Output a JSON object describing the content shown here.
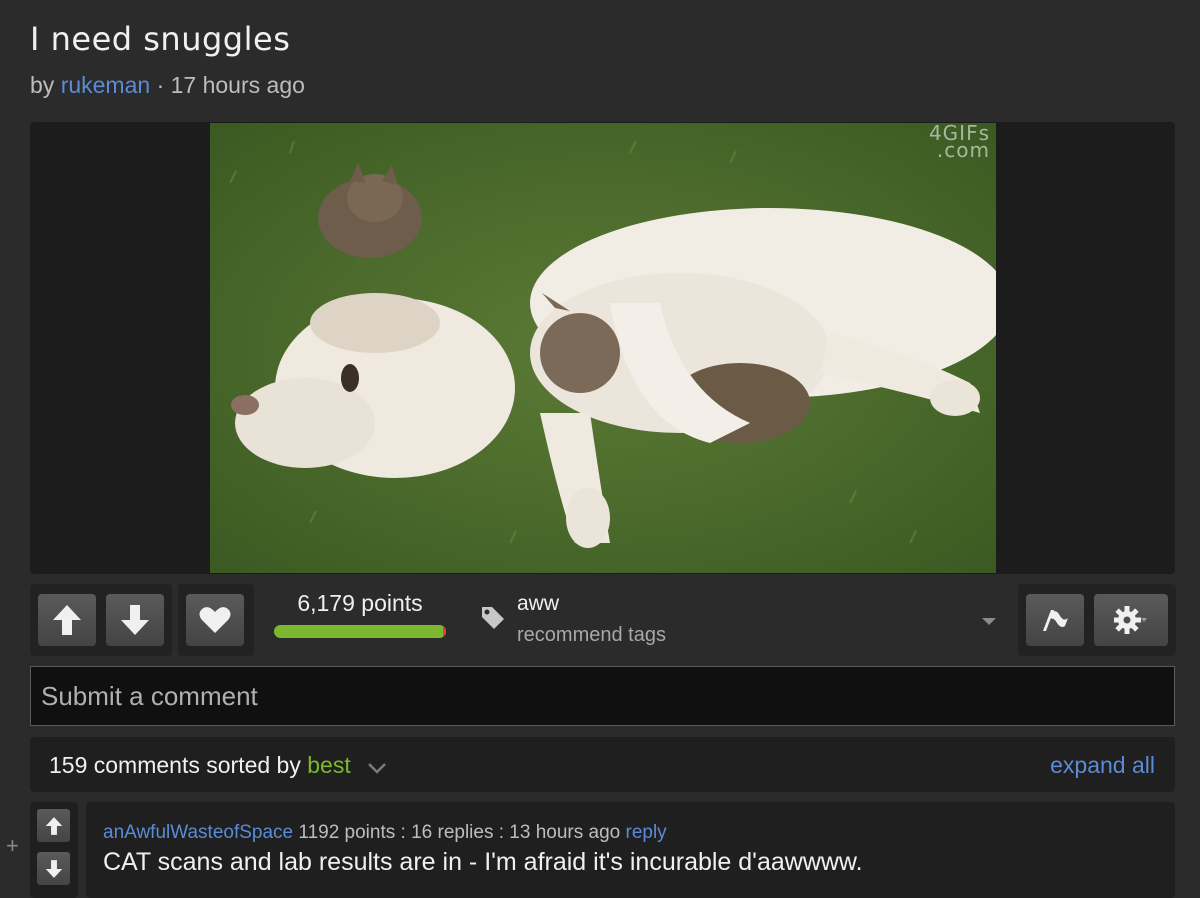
{
  "post": {
    "title": "I need snuggles",
    "by_label": "by",
    "author": "rukeman",
    "separator": "·",
    "time": "17 hours ago",
    "watermark_line1": "4GIFs",
    "watermark_line2": ".com"
  },
  "actions": {
    "points": "6,179 points",
    "score_fraction": 0.98,
    "tag": "aww",
    "tag_sub": "recommend tags"
  },
  "comment_input": {
    "placeholder": "Submit a comment"
  },
  "sort": {
    "count_text": "159 comments sorted by",
    "sort_value": "best",
    "expand_all": "expand all"
  },
  "comments": [
    {
      "collapse_toggle": "+",
      "user": "anAwfulWasteofSpace",
      "meta": "1192 points : 16 replies : 13 hours ago",
      "reply": "reply",
      "text": "CAT scans and lab results are in - I'm afraid it's incurable d'aawwww."
    }
  ],
  "colors": {
    "background": "#2b2b2b",
    "link": "#5b8bd6",
    "accent_green": "#7cb82f",
    "downvote_red": "#e04040"
  }
}
